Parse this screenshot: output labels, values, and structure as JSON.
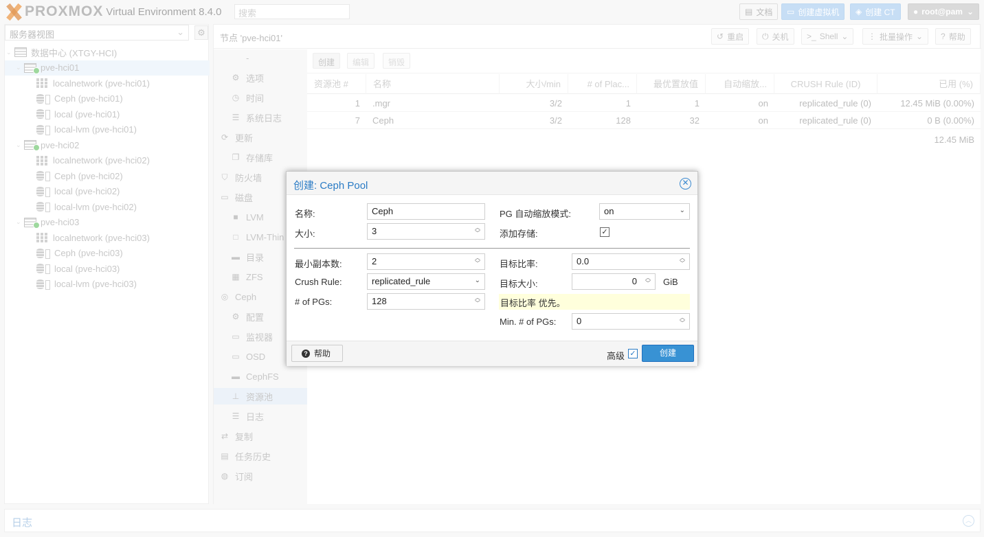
{
  "header": {
    "brand": "PROXMOX",
    "version_label": "Virtual Environment 8.4.0",
    "search_placeholder": "搜索",
    "docs_label": "文档",
    "create_vm_label": "创建虚拟机",
    "create_ct_label": "创建 CT",
    "user_label": "root@pam"
  },
  "sidebar": {
    "view_select": "服务器视图",
    "tree": [
      {
        "label": "数据中心 (XTGY-HCI)",
        "type": "datacenter",
        "level": 0
      },
      {
        "label": "pve-hci01",
        "type": "node",
        "level": 1,
        "selected": true
      },
      {
        "label": "localnetwork (pve-hci01)",
        "type": "network",
        "level": 2
      },
      {
        "label": "Ceph (pve-hci01)",
        "type": "storage",
        "level": 2
      },
      {
        "label": "local (pve-hci01)",
        "type": "storage",
        "level": 2
      },
      {
        "label": "local-lvm (pve-hci01)",
        "type": "storage",
        "level": 2
      },
      {
        "label": "pve-hci02",
        "type": "node",
        "level": 1
      },
      {
        "label": "localnetwork (pve-hci02)",
        "type": "network",
        "level": 2
      },
      {
        "label": "Ceph (pve-hci02)",
        "type": "storage",
        "level": 2
      },
      {
        "label": "local (pve-hci02)",
        "type": "storage",
        "level": 2
      },
      {
        "label": "local-lvm (pve-hci02)",
        "type": "storage",
        "level": 2
      },
      {
        "label": "pve-hci03",
        "type": "node",
        "level": 1
      },
      {
        "label": "localnetwork (pve-hci03)",
        "type": "network",
        "level": 2
      },
      {
        "label": "Ceph (pve-hci03)",
        "type": "storage",
        "level": 2
      },
      {
        "label": "local (pve-hci03)",
        "type": "storage",
        "level": 2
      },
      {
        "label": "local-lvm (pve-hci03)",
        "type": "storage",
        "level": 2
      }
    ]
  },
  "node_header": {
    "title": "节点 'pve-hci01'",
    "reboot_label": "重启",
    "shutdown_label": "关机",
    "shell_label": "Shell",
    "bulk_label": "批量操作",
    "help_label": "帮助"
  },
  "node_menu": [
    {
      "label": "-",
      "icon": "",
      "kind": "sub"
    },
    {
      "label": "选项",
      "icon": "gear-icon",
      "kind": "sub"
    },
    {
      "label": "时间",
      "icon": "clock-icon",
      "kind": "sub"
    },
    {
      "label": "系统日志",
      "icon": "list-icon",
      "kind": "sub"
    },
    {
      "label": "更新",
      "icon": "refresh-icon",
      "kind": "top"
    },
    {
      "label": "存储库",
      "icon": "copy-icon",
      "kind": "sub"
    },
    {
      "label": "防火墙",
      "icon": "shield-icon",
      "kind": "top"
    },
    {
      "label": "磁盘",
      "icon": "hdd-icon",
      "kind": "top"
    },
    {
      "label": "LVM",
      "icon": "square-icon",
      "kind": "sub"
    },
    {
      "label": "LVM-Thin",
      "icon": "square-outline-icon",
      "kind": "sub"
    },
    {
      "label": "目录",
      "icon": "folder-icon",
      "kind": "sub"
    },
    {
      "label": "ZFS",
      "icon": "grid-icon",
      "kind": "sub"
    },
    {
      "label": "Ceph",
      "icon": "ceph-icon",
      "kind": "top"
    },
    {
      "label": "配置",
      "icon": "gear-icon",
      "kind": "sub"
    },
    {
      "label": "监视器",
      "icon": "desktop-icon",
      "kind": "sub"
    },
    {
      "label": "OSD",
      "icon": "hdd-icon",
      "kind": "sub"
    },
    {
      "label": "CephFS",
      "icon": "folder-icon",
      "kind": "sub"
    },
    {
      "label": "资源池",
      "icon": "sitemap-icon",
      "kind": "sub",
      "selected": true
    },
    {
      "label": "日志",
      "icon": "list-icon",
      "kind": "sub"
    },
    {
      "label": "复制",
      "icon": "retweet-icon",
      "kind": "top"
    },
    {
      "label": "任务历史",
      "icon": "list-alt-icon",
      "kind": "top"
    },
    {
      "label": "订阅",
      "icon": "support-icon",
      "kind": "top"
    }
  ],
  "pool_grid": {
    "toolbar": {
      "create": "创建",
      "edit": "编辑",
      "destroy": "销毁"
    },
    "columns": [
      "资源池 #",
      "名称",
      "大小/min",
      "# of Plac...",
      "最优置放值",
      "自动缩放...",
      "CRUSH Rule (ID)",
      "已用 (%)"
    ],
    "rows": [
      {
        "id": "1",
        "name": ".mgr",
        "size": "3/2",
        "pgs": "1",
        "optimal": "1",
        "autoscale": "on",
        "rule": "replicated_rule (0)",
        "used": "12.45 MiB (0.00%)"
      },
      {
        "id": "7",
        "name": "Ceph",
        "size": "3/2",
        "pgs": "128",
        "optimal": "32",
        "autoscale": "on",
        "rule": "replicated_rule (0)",
        "used": "0 B (0.00%)"
      }
    ],
    "total_used": "12.45 MiB"
  },
  "dialog": {
    "title": "创建: Ceph Pool",
    "name_label": "名称:",
    "name_value": "Ceph",
    "size_label": "大小:",
    "size_value": "3",
    "pg_mode_label": "PG 自动缩放模式:",
    "pg_mode_value": "on",
    "add_storage_label": "添加存储:",
    "add_storage_checked": true,
    "min_size_label": "最小副本数:",
    "min_size_value": "2",
    "crush_label": "Crush Rule:",
    "crush_value": "replicated_rule",
    "pgs_label": "# of PGs:",
    "pgs_value": "128",
    "target_ratio_label": "目标比率:",
    "target_ratio_value": "0.0",
    "target_size_label": "目标大小:",
    "target_size_value": "0",
    "target_size_unit": "GiB",
    "note": "目标比率 优先。",
    "min_pgs_label": "Min. # of PGs:",
    "min_pgs_value": "0",
    "help_label": "帮助",
    "advanced_label": "高级",
    "advanced_checked": true,
    "create_label": "创建"
  },
  "log_panel": {
    "title": "日志"
  }
}
